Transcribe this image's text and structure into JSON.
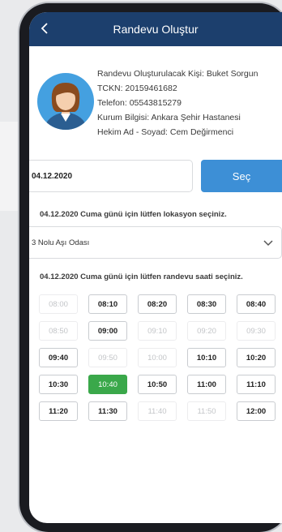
{
  "header": {
    "title": "Randevu Oluştur"
  },
  "person": {
    "name_line": "Randevu Oluşturulacak Kişi: Buket Sorgun",
    "tckn_line": "TCKN: 20159461682",
    "phone_line": "Telefon: 05543815279",
    "institution_line": "Kurum Bilgisi: Ankara Şehir Hastanesi",
    "doctor_line": "Hekim Ad - Soyad: Cem Değirmenci"
  },
  "date": {
    "value": "04.12.2020",
    "button_label": "Seç"
  },
  "location": {
    "prompt": "04.12.2020 Cuma günü için lütfen lokasyon seçiniz.",
    "selected": "3 Nolu Aşı Odası"
  },
  "time": {
    "prompt": "04.12.2020 Cuma günü için lütfen randevu saati seçiniz.",
    "slots": [
      {
        "label": "08:00",
        "state": "disabled"
      },
      {
        "label": "08:10",
        "state": "available"
      },
      {
        "label": "08:20",
        "state": "available"
      },
      {
        "label": "08:30",
        "state": "available"
      },
      {
        "label": "08:40",
        "state": "available"
      },
      {
        "label": "08:50",
        "state": "disabled"
      },
      {
        "label": "09:00",
        "state": "available"
      },
      {
        "label": "09:10",
        "state": "disabled"
      },
      {
        "label": "09:20",
        "state": "disabled"
      },
      {
        "label": "09:30",
        "state": "disabled"
      },
      {
        "label": "09:40",
        "state": "available"
      },
      {
        "label": "09:50",
        "state": "disabled"
      },
      {
        "label": "10:00",
        "state": "disabled"
      },
      {
        "label": "10:10",
        "state": "available"
      },
      {
        "label": "10:20",
        "state": "available"
      },
      {
        "label": "10:30",
        "state": "available"
      },
      {
        "label": "10:40",
        "state": "selected"
      },
      {
        "label": "10:50",
        "state": "available"
      },
      {
        "label": "11:00",
        "state": "available"
      },
      {
        "label": "11:10",
        "state": "available"
      },
      {
        "label": "11:20",
        "state": "available"
      },
      {
        "label": "11:30",
        "state": "available"
      },
      {
        "label": "11:40",
        "state": "disabled"
      },
      {
        "label": "11:50",
        "state": "disabled"
      },
      {
        "label": "12:00",
        "state": "available"
      }
    ]
  },
  "icons": {
    "back": "chevron-left-icon",
    "avatar": "avatar-icon",
    "dropdown": "chevron-down-icon"
  },
  "colors": {
    "header": "#1c3f6d",
    "button": "#3d8fd6",
    "selected_slot": "#3aa84a",
    "avatar_bg": "#44a0e0"
  }
}
